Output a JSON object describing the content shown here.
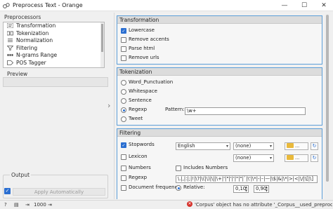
{
  "window": {
    "title": "Preprocess Text - Orange",
    "minimize_glyph": "—",
    "maximize_glyph": "☐",
    "close_glyph": "✕"
  },
  "left": {
    "preprocessors_label": "Preprocessors",
    "items": [
      {
        "label": "Transformation",
        "icon": "transformation-icon"
      },
      {
        "label": "Tokenization",
        "icon": "tokenization-icon"
      },
      {
        "label": "Normalization",
        "icon": "normalization-icon"
      },
      {
        "label": "Filtering",
        "icon": "filtering-icon"
      },
      {
        "label": "N-grams Range",
        "icon": "ngrams-icon"
      },
      {
        "label": "POS Tagger",
        "icon": "pos-tagger-icon"
      }
    ],
    "preview_label": "Preview",
    "output_label": "Output",
    "apply_label": "Apply Automatically",
    "apply_checked": true
  },
  "transformation": {
    "title": "Transformation",
    "options": [
      {
        "label": "Lowercase",
        "checked": true
      },
      {
        "label": "Remove accents",
        "checked": false
      },
      {
        "label": "Parse html",
        "checked": false
      },
      {
        "label": "Remove urls",
        "checked": false
      }
    ]
  },
  "tokenization": {
    "title": "Tokenization",
    "options": [
      {
        "label": "Word_Punctuation",
        "selected": false
      },
      {
        "label": "Whitespace",
        "selected": false
      },
      {
        "label": "Sentence",
        "selected": false
      },
      {
        "label": "Regexp",
        "selected": true
      },
      {
        "label": "Tweet",
        "selected": false
      }
    ],
    "pattern_label": "Pattern:",
    "pattern_value": "\\w+"
  },
  "filtering": {
    "title": "Filtering",
    "stopwords_label": "Stopwords",
    "stopwords_checked": true,
    "stopwords_language": "English",
    "stopwords_file": "(none)",
    "lexicon_label": "Lexicon",
    "lexicon_checked": false,
    "lexicon_file": "(none)",
    "folder_btn_label": "...",
    "numbers_label": "Numbers",
    "numbers_checked": false,
    "includes_numbers_label": "Includes Numbers",
    "includes_numbers_checked": false,
    "regexp_label": "Regexp",
    "regexp_checked": false,
    "regexp_value": "\\.|,|:|;|!|\\?|\\(|\\)|\\||\\+|'|\"|'|'|\"|\"|`|\\'|\\*|-|–|—|\\$|&|\\*|>|<|\\/|\\[|\\]",
    "docfreq_label": "Document frequency",
    "docfreq_checked": false,
    "relative_label": "Relative:",
    "relative_min": "0,10",
    "relative_max": "0,90"
  },
  "status": {
    "items_count": "1000",
    "error_text": "'Corpus' object has no attribute '_Corpus__used_preprocessor'"
  },
  "colors": {
    "accent": "#2b6fd1",
    "box_border": "#5c9ed8",
    "error": "#d6322c"
  }
}
